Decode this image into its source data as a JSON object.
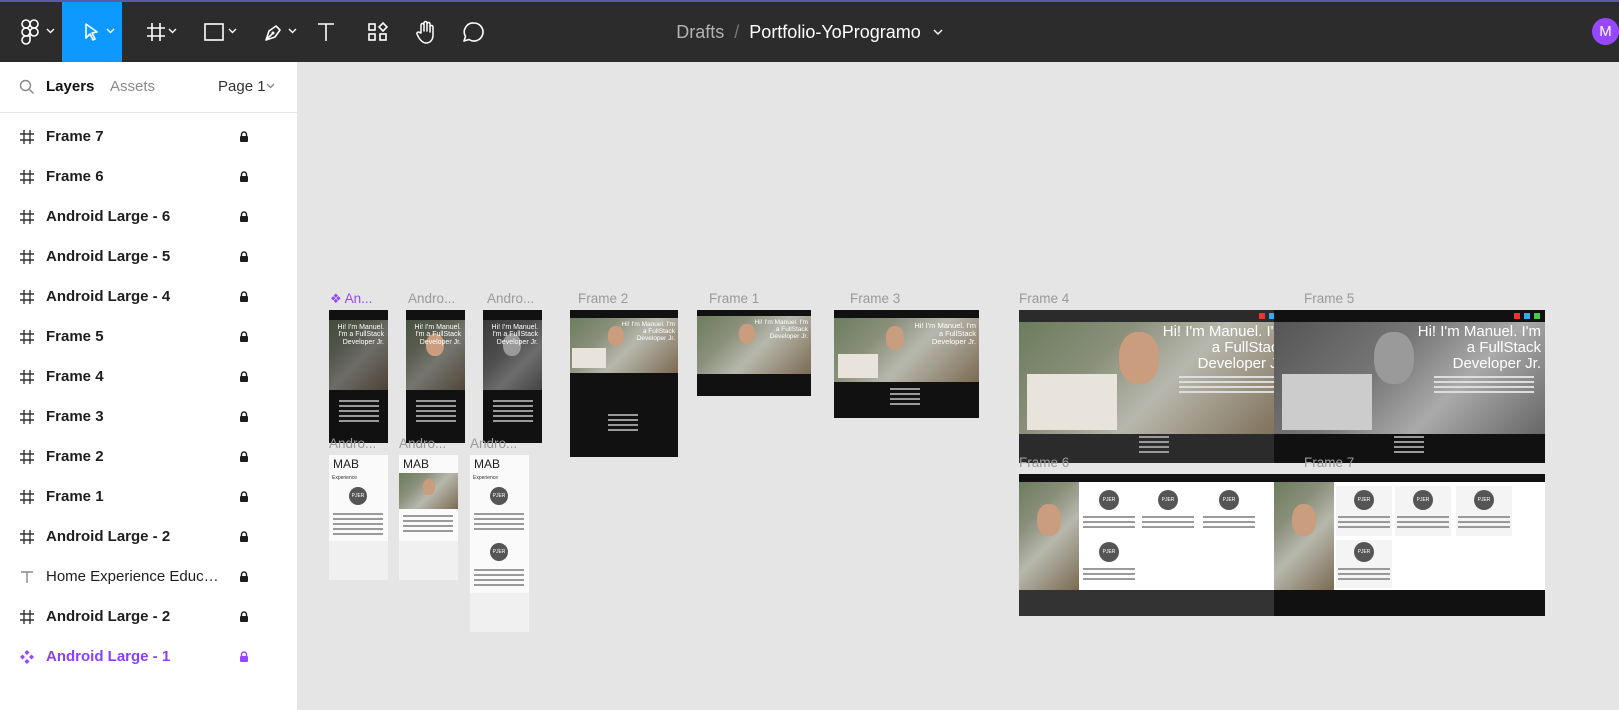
{
  "toolbar": {
    "tools": [
      "main-menu",
      "move",
      "frame",
      "shape",
      "pen",
      "text",
      "resources",
      "hand",
      "comment"
    ],
    "breadcrumb": {
      "project": "Drafts",
      "separator": "/",
      "file": "Portfolio-YoProgramo"
    },
    "avatar_initial": "M",
    "accent": "#0d99ff"
  },
  "left_panel": {
    "tabs": {
      "layers": "Layers",
      "assets": "Assets"
    },
    "page": "Page 1",
    "layers": [
      {
        "name": "Frame 7",
        "icon": "frame-icon",
        "locked": true
      },
      {
        "name": "Frame 6",
        "icon": "frame-icon",
        "locked": true
      },
      {
        "name": "Android Large - 6",
        "icon": "frame-icon",
        "locked": true
      },
      {
        "name": "Android Large - 5",
        "icon": "frame-icon",
        "locked": true
      },
      {
        "name": "Android Large - 4",
        "icon": "frame-icon",
        "locked": true
      },
      {
        "name": "Frame 5",
        "icon": "frame-icon",
        "locked": true
      },
      {
        "name": "Frame 4",
        "icon": "frame-icon",
        "locked": true
      },
      {
        "name": "Frame 3",
        "icon": "frame-icon",
        "locked": true
      },
      {
        "name": "Frame 2",
        "icon": "frame-icon",
        "locked": true
      },
      {
        "name": "Frame 1",
        "icon": "frame-icon",
        "locked": true
      },
      {
        "name": "Android Large - 2",
        "icon": "frame-icon",
        "locked": true
      },
      {
        "name": "Home Experience Educati...",
        "icon": "text-icon",
        "locked": true
      },
      {
        "name": "Android Large - 2",
        "icon": "frame-icon",
        "locked": true
      },
      {
        "name": "Android Large - 1",
        "icon": "component-icon",
        "locked": true
      }
    ],
    "component_color": "#9747ff"
  },
  "canvas": {
    "frame_labels": {
      "an1": "An...",
      "andro_a": "Andro...",
      "andro_b": "Andro...",
      "frame2": "Frame 2",
      "frame1": "Frame 1",
      "frame3": "Frame 3",
      "frame4": "Frame 4",
      "frame5": "Frame 5",
      "andro_c": "Andro...",
      "andro_d": "Andro...",
      "andro_e": "Andro...",
      "frame6": "Frame 6",
      "frame7": "Frame 7"
    },
    "hero": {
      "line1": "Hi! I'm Manuel. I'm",
      "line2": "a FullStack",
      "line3": "Developer Jr."
    },
    "mobile_hero": {
      "line1": "Hi! I'm Manuel.",
      "line2": "I'm a FullStack",
      "line3": "Developer Jr."
    },
    "logo_text": "MAB",
    "section_title": "Experience",
    "badge_text": "PJER"
  }
}
